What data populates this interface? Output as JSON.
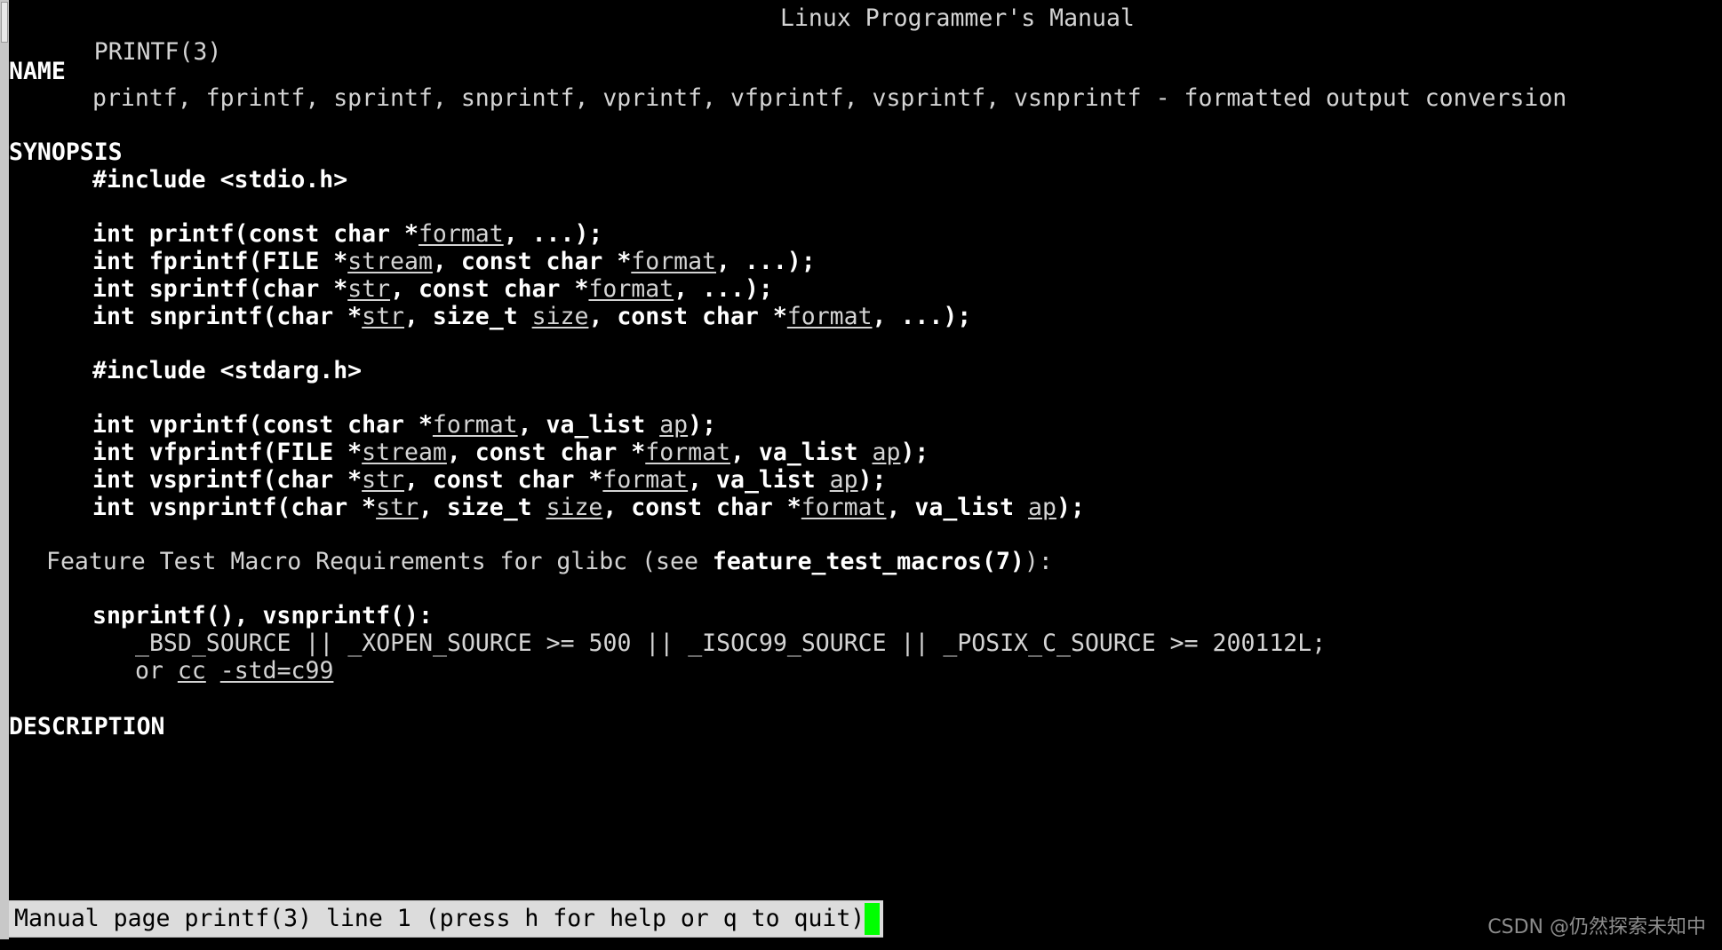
{
  "window": {
    "title": "PRINTF(3)",
    "background_color": "#000000",
    "foreground_color": "#d4d4d4",
    "cursor_color": "#00ff00"
  },
  "header": {
    "left": "PRINTF(3)",
    "center": "Linux Programmer's Manual"
  },
  "sections": {
    "name": {
      "heading": "NAME",
      "body": "printf, fprintf, sprintf, snprintf, vprintf, vfprintf, vsprintf, vsnprintf - formatted output conversion"
    },
    "synopsis": {
      "heading": "SYNOPSIS",
      "include_stdio": "#include <stdio.h>",
      "include_stdarg": "#include <stdarg.h>",
      "proto_printf": {
        "pre": "int printf(const char *",
        "param1": "format",
        "post": ", ...);"
      },
      "proto_fprintf": {
        "pre": "int fprintf(FILE *",
        "param1": "stream",
        "mid1": ", const char *",
        "param2": "format",
        "post": ", ...);"
      },
      "proto_sprintf": {
        "pre": "int sprintf(char *",
        "param1": "str",
        "mid1": ", const char *",
        "param2": "format",
        "post": ", ...);"
      },
      "proto_snprintf": {
        "pre": "int snprintf(char *",
        "param1": "str",
        "mid1": ", size_t ",
        "param2": "size",
        "mid2": ", const char *",
        "param3": "format",
        "post": ", ...);"
      },
      "proto_vprintf": {
        "pre": "int vprintf(const char *",
        "param1": "format",
        "mid1": ", va_list ",
        "param2": "ap",
        "post": ");"
      },
      "proto_vfprintf": {
        "pre": "int vfprintf(FILE *",
        "param1": "stream",
        "mid1": ", const char *",
        "param2": "format",
        "mid2": ", va_list ",
        "param3": "ap",
        "post": ");"
      },
      "proto_vsprintf": {
        "pre": "int vsprintf(char *",
        "param1": "str",
        "mid1": ", const char *",
        "param2": "format",
        "mid2": ", va_list ",
        "param3": "ap",
        "post": ");"
      },
      "proto_vsnprintf": {
        "pre": "int vsnprintf(char *",
        "param1": "str",
        "mid1": ", size_t ",
        "param2": "size",
        "mid2": ", const char *",
        "param3": "format",
        "mid3": ", va_list ",
        "param4": "ap",
        "post": ");"
      },
      "feature_test": {
        "pre": "Feature Test Macro Requirements for glibc (see ",
        "bold": "feature_test_macros(7)",
        "post": "):"
      },
      "ftm_functions": "snprintf(), vsnprintf():",
      "ftm_requirement": "_BSD_SOURCE || _XOPEN_SOURCE >= 500 || _ISOC99_SOURCE || _POSIX_C_SOURCE >= 200112L;",
      "ftm_alt_pre": "or ",
      "ftm_alt_cc": "cc",
      "ftm_alt_space": " ",
      "ftm_alt_flag": "-std=c99"
    },
    "description": {
      "heading": "DESCRIPTION"
    }
  },
  "statusbar": {
    "text": "Manual page printf(3) line 1 (press h for help or q to quit)"
  },
  "watermark": {
    "text": "CSDN @仍然探索未知中"
  }
}
